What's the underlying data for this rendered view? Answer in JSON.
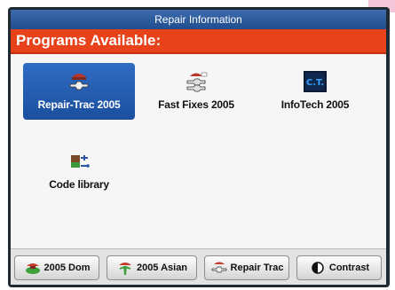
{
  "window": {
    "title": "Repair Information"
  },
  "banner": {
    "text": "Programs Available:"
  },
  "programs": [
    {
      "label": "Repair-Trac 2005",
      "icon": "repair-trac-icon",
      "selected": true
    },
    {
      "label": "Fast Fixes 2005",
      "icon": "fast-fixes-icon",
      "selected": false
    },
    {
      "label": "InfoTech 2005",
      "icon": "infotech-icon",
      "icon_text": "C.T.",
      "selected": false
    },
    {
      "label": "Code library",
      "icon": "code-library-icon",
      "selected": false
    }
  ],
  "toolbar": {
    "dom_label": "2005 Dom",
    "asian_label": "2005 Asian",
    "repair_label": "Repair Trac",
    "contrast_label": "Contrast"
  },
  "colors": {
    "banner": "#e8421a",
    "title_bar": "#2a5a9c",
    "selected": "#2f6cc4"
  }
}
